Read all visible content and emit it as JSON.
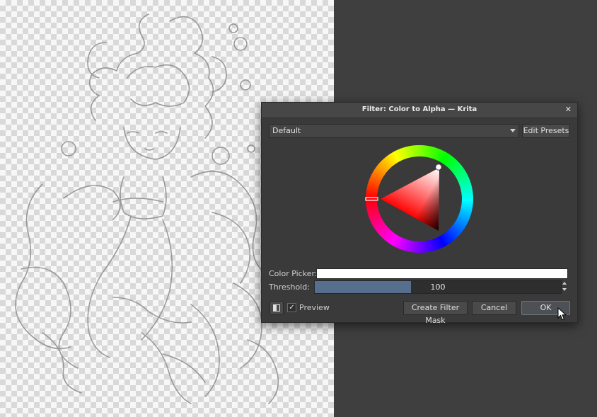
{
  "dialog": {
    "title": "Filter: Color to Alpha — Krita",
    "close_glyph": "✕",
    "preset": {
      "selected": "Default",
      "edit_presets_label": "Edit Presets"
    },
    "color_picker_label": "Color Picker:",
    "color_picker_value": "#ffffff",
    "threshold": {
      "label": "Threshold:",
      "value": "100",
      "fill_fraction": 0.39
    },
    "preview": {
      "checked": true,
      "check_glyph": "✓",
      "label": "Preview"
    },
    "buttons": {
      "create_filter_mask": "Create Filter Mask",
      "cancel": "Cancel",
      "ok": "OK"
    }
  },
  "icons": {
    "close": "close-icon",
    "dropdown": "chevron-down-icon",
    "toggle": "split-view-icon",
    "cursor": "mouse-pointer-icon"
  }
}
